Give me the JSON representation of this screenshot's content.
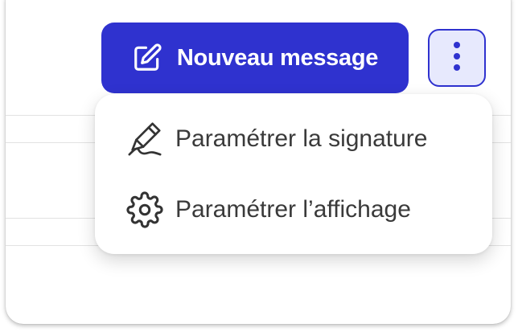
{
  "toolbar": {
    "new_message_label": "Nouveau message",
    "new_message_icon": "edit-square-icon",
    "more_icon": "more-vertical-icon"
  },
  "menu": {
    "items": [
      {
        "label": "Paramétrer la signature",
        "icon": "signature-pen-icon"
      },
      {
        "label": "Paramétrer l’affichage",
        "icon": "gear-icon"
      }
    ]
  },
  "colors": {
    "accent": "#2f32cf",
    "accent_light": "#e7e9fd",
    "menu_text": "#3a3a3a",
    "icon_stroke": "#333333"
  }
}
